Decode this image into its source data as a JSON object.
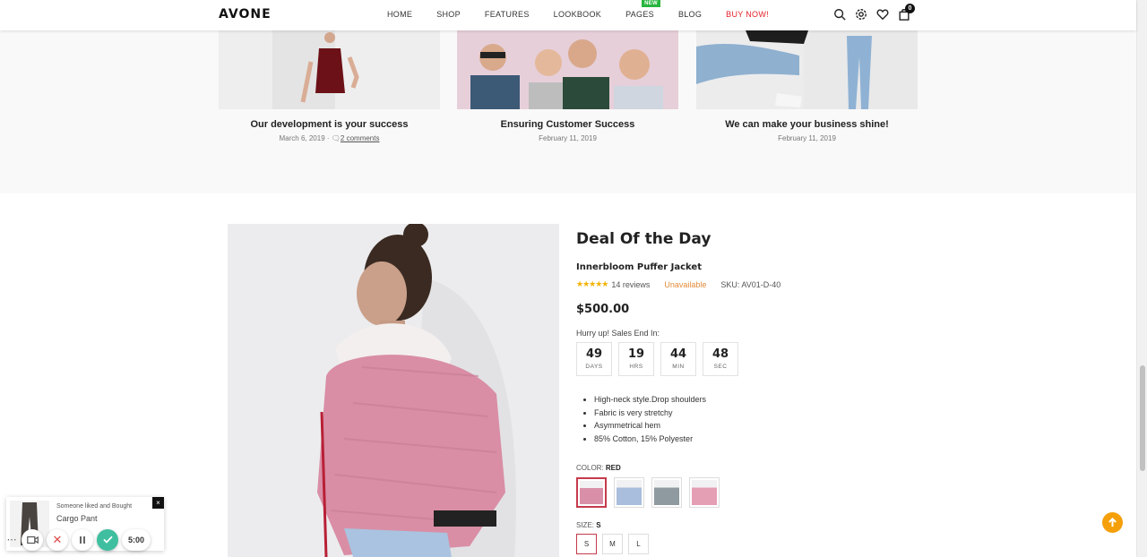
{
  "header": {
    "logo": "AVONE",
    "nav": [
      {
        "label": "HOME",
        "name": "nav-home"
      },
      {
        "label": "SHOP",
        "name": "nav-shop"
      },
      {
        "label": "FEATURES",
        "name": "nav-features"
      },
      {
        "label": "LOOKBOOK",
        "name": "nav-lookbook"
      },
      {
        "label": "PAGES",
        "name": "nav-pages",
        "badge": "NEW"
      },
      {
        "label": "BLOG",
        "name": "nav-blog"
      },
      {
        "label": "BUY NOW!",
        "name": "nav-buy-now"
      }
    ],
    "cart_count": "0",
    "icons": [
      "search-icon",
      "settings-icon",
      "heart-icon",
      "cart-icon"
    ]
  },
  "blog": {
    "posts": [
      {
        "title": "Our development is your success",
        "date": "March 6, 2019",
        "comments": "2 comments"
      },
      {
        "title": "Ensuring Customer Success",
        "date": "February 11, 2019",
        "comments": ""
      },
      {
        "title": "We can make your business shine!",
        "date": "February 11, 2019",
        "comments": ""
      }
    ]
  },
  "deal": {
    "heading": "Deal Of the Day",
    "product_name": "Innerbloom Puffer Jacket",
    "rating": 5,
    "reviews": "14 reviews",
    "availability": "Unavailable",
    "sku": "SKU: AV01-D-40",
    "price": "$500.00",
    "hurry": "Hurry up! Sales End In:",
    "countdown": [
      {
        "value": "49",
        "unit": "DAYS"
      },
      {
        "value": "19",
        "unit": "HRS"
      },
      {
        "value": "44",
        "unit": "MIN"
      },
      {
        "value": "48",
        "unit": "SEC"
      }
    ],
    "features": [
      "High-neck style.Drop shoulders",
      "Fabric is very stretchy",
      "Asymmetrical hem",
      "85% Cotton, 15% Polyester"
    ],
    "color_label": "COLOR:",
    "color_value": "RED",
    "swatches": [
      "#d98fa8",
      "#a9bddc",
      "#8f9aa0",
      "#e59fb5"
    ],
    "size_label": "SIZE:",
    "size_value": "S",
    "sizes": [
      "S",
      "M",
      "L"
    ]
  },
  "popup": {
    "line1": "Someone liked and Bought",
    "product": "Cargo Pant",
    "close": "×"
  },
  "recorder": {
    "time": "5:00"
  },
  "colors": {
    "accent": "#e3222a",
    "new_badge": "#28b53f",
    "back_to_top": "#f5a00a",
    "availability": "#e58b3a",
    "swatch_active": "#c53a4c"
  }
}
